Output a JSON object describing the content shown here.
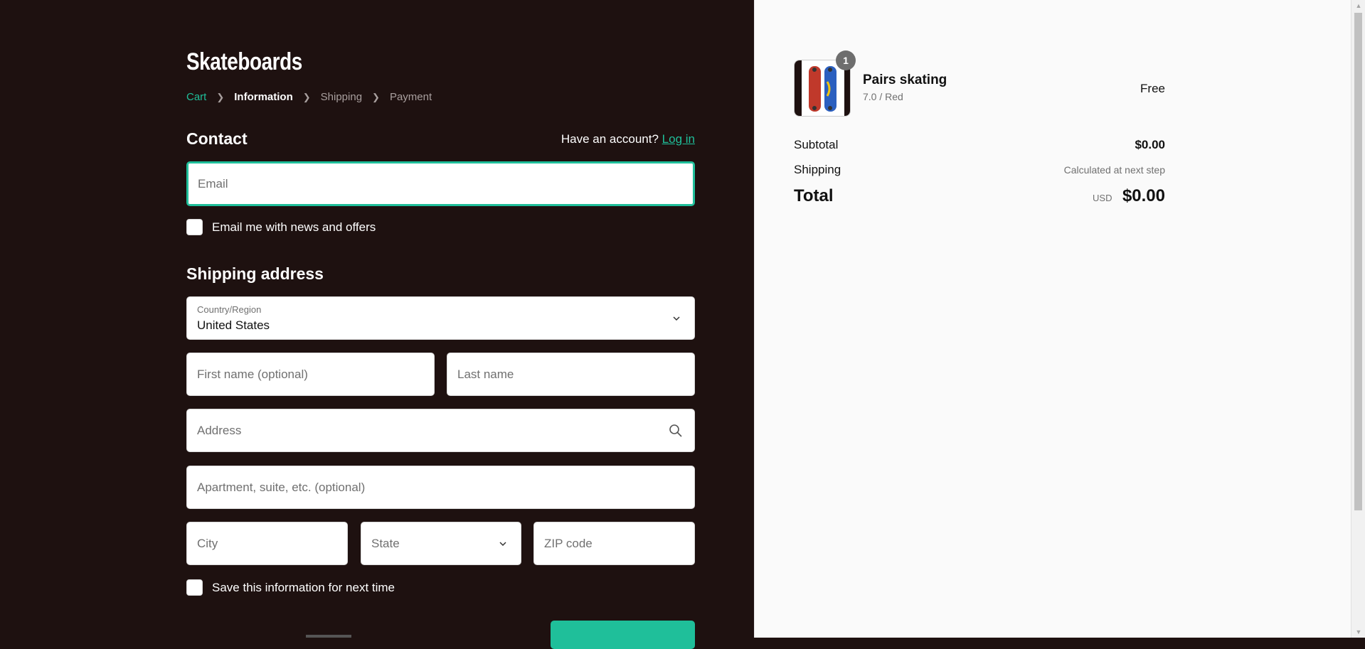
{
  "store": {
    "title": "Skateboards"
  },
  "breadcrumb": {
    "cart": "Cart",
    "information": "Information",
    "shipping": "Shipping",
    "payment": "Payment"
  },
  "contact": {
    "title": "Contact",
    "have_account": "Have an account?",
    "login": "Log in",
    "email_placeholder": "Email",
    "news_label": "Email me with news and offers"
  },
  "shipping_address": {
    "title": "Shipping address",
    "country_label": "Country/Region",
    "country_value": "United States",
    "first_name_placeholder": "First name (optional)",
    "last_name_placeholder": "Last name",
    "address_placeholder": "Address",
    "apartment_placeholder": "Apartment, suite, etc. (optional)",
    "city_placeholder": "City",
    "state_placeholder": "State",
    "zip_placeholder": "ZIP code",
    "save_label": "Save this information for next time"
  },
  "order": {
    "product_name": "Pairs skating",
    "product_variant": "7.0 / Red",
    "product_price": "Free",
    "quantity": "1",
    "subtotal_label": "Subtotal",
    "subtotal_value": "$0.00",
    "shipping_label": "Shipping",
    "shipping_value": "Calculated at next step",
    "total_label": "Total",
    "total_currency": "USD",
    "total_value": "$0.00"
  },
  "colors": {
    "accent": "#1fbf9a",
    "left_bg": "#1e1110",
    "right_bg": "#fafafa"
  },
  "icons": {
    "breadcrumb_separator": "chevron-right-icon",
    "select": "chevron-down-icon",
    "address_search": "search-icon"
  }
}
